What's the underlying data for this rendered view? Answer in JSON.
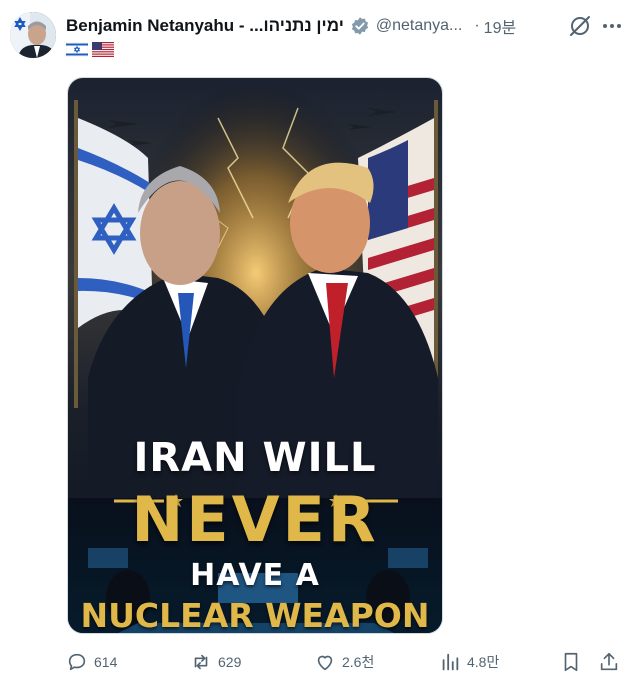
{
  "post": {
    "author_name": "Benjamin Netanyahu - בנימין נתניהו",
    "author_name_display": "Benjamin Netanyahu - ...ימין נתניהו",
    "handle": "@netanya...",
    "separator": "·",
    "time": "19분",
    "flags": [
      "israel-flag",
      "usa-flag"
    ]
  },
  "media": {
    "headline_line1": "IRAN WILL",
    "headline_line2": "NEVER",
    "headline_line3": "HAVE A",
    "headline_line4": "NUCLEAR WEAPON",
    "icons": [
      "israel-flag",
      "usa-flag",
      "fighter-jet-icon",
      "star-icon"
    ]
  },
  "actions": {
    "reply_count": "614",
    "repost_count": "629",
    "like_count": "2.6천",
    "views_count": "4.8만"
  },
  "icons": [
    "verified-badge-icon",
    "grok-icon",
    "more-icon",
    "reply-icon",
    "repost-icon",
    "like-icon",
    "views-icon",
    "bookmark-icon",
    "share-icon"
  ],
  "colors": {
    "text_primary": "#0f1419",
    "text_secondary": "#536471",
    "verified_gray": "#829aab",
    "headline_gold": "#e0b84a"
  }
}
